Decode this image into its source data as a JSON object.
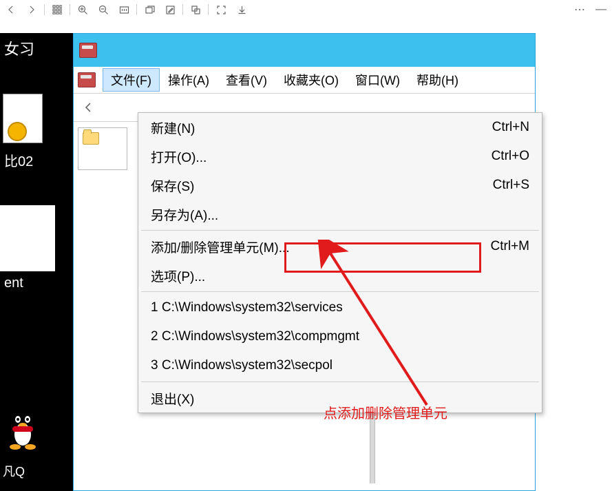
{
  "viewer_toolbar": {
    "back": "back",
    "fwd": "forward",
    "grid": "apps",
    "zoom_in": "zoom-in",
    "zoom_out": "zoom-out",
    "fit": "fit-width",
    "new_win": "new-window",
    "edit": "edit",
    "copy": "copy",
    "full": "fullscreen",
    "save": "download",
    "more": "⋯",
    "min": "—"
  },
  "desk": {
    "frag1": "女习",
    "frag2": "比02",
    "frag3": "ent",
    "frag4": "凡Q"
  },
  "mmc": {
    "menubar": {
      "file": "文件(F)",
      "action": "操作(A)",
      "view": "查看(V)",
      "fav": "收藏夹(O)",
      "window": "窗口(W)",
      "help": "帮助(H)"
    },
    "dropdown": {
      "new": {
        "label": "新建(N)",
        "shortcut": "Ctrl+N"
      },
      "open": {
        "label": "打开(O)...",
        "shortcut": "Ctrl+O"
      },
      "save": {
        "label": "保存(S)",
        "shortcut": "Ctrl+S"
      },
      "saveas": {
        "label": "另存为(A)...",
        "shortcut": ""
      },
      "snapin": {
        "label": "添加/删除管理单元(M)...",
        "shortcut": "Ctrl+M"
      },
      "options": {
        "label": "选项(P)...",
        "shortcut": ""
      },
      "recent1": {
        "label": "1 C:\\Windows\\system32\\services",
        "shortcut": ""
      },
      "recent2": {
        "label": "2 C:\\Windows\\system32\\compmgmt",
        "shortcut": ""
      },
      "recent3": {
        "label": "3 C:\\Windows\\system32\\secpol",
        "shortcut": ""
      },
      "exit": {
        "label": "退出(X)",
        "shortcut": ""
      }
    }
  },
  "annotation": "点添加删除管理单元"
}
